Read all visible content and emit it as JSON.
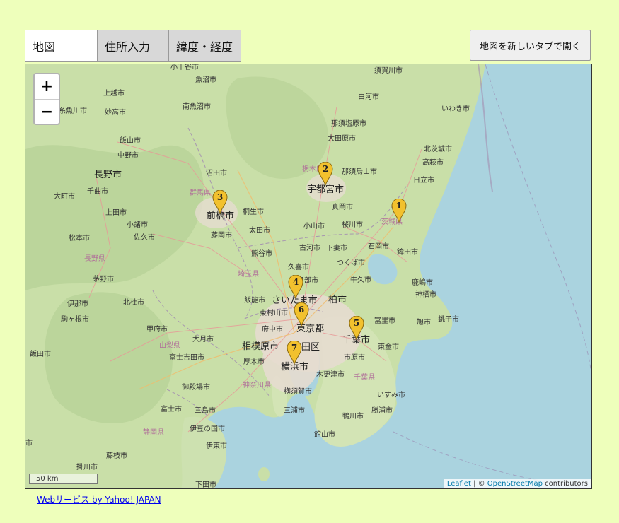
{
  "tabs": [
    {
      "label": "地図",
      "active": true
    },
    {
      "label": "住所入力",
      "active": false
    },
    {
      "label": "緯度・経度",
      "active": false
    }
  ],
  "open_new_tab_button": "地図を新しいタブで開く",
  "map": {
    "zoom_in": "+",
    "zoom_out": "−",
    "scale_label": "50 km",
    "attribution": {
      "leaflet": "Leaflet",
      "sep": " | © ",
      "osm": "OpenStreetMap",
      "suffix": " contributors"
    },
    "colors": {
      "sea": "#aad3df",
      "land": "#c9dfa8",
      "mountain": "#b8d297",
      "urban": "#e6dccf",
      "marker": "#f2c12e"
    },
    "markers": [
      "1",
      "2",
      "3",
      "4",
      "5",
      "6",
      "7"
    ],
    "labels": {
      "komagi": "小千谷市",
      "uonuma": "魚沼市",
      "sukagawa": "須賀川市",
      "joetsu": "上越市",
      "shirakawa": "白河市",
      "itoigawa": "糸魚川市",
      "myoko": "妙高市",
      "minamiuonuma": "南魚沼市",
      "iwaki": "いわき市",
      "iiyama": "飯山市",
      "nasushiobara": "那須塩原市",
      "nakano": "中野市",
      "otawara": "大田原市",
      "kitaibaraki": "北茨城市",
      "nagano": "長野市",
      "numata": "沼田市",
      "tochigi_pref": "栃木県",
      "nasukarasuyama": "那須烏山市",
      "takahagi": "高萩市",
      "chikuma": "千曲市",
      "gunma_pref": "群馬県",
      "utsunomiya": "宇都宮市",
      "hitachi": "日立市",
      "omachi": "大町市",
      "maebashi": "前橋市",
      "kiryu": "桐生市",
      "moka": "真岡市",
      "ueda": "上田市",
      "komoro": "小諸市",
      "ota": "太田市",
      "oyama": "小山市",
      "sakura": "桜川市",
      "ibaraki_pref": "茨城県",
      "matsumoto": "松本市",
      "saku": "佐久市",
      "fujioka": "藤岡市",
      "koga": "古河市",
      "shimotsuma": "下妻市",
      "ishioka": "石岡市",
      "hokota": "鉾田市",
      "nagano_pref": "長野県",
      "kumagaya": "熊谷市",
      "tsukuba": "つくば市",
      "kuki": "久喜市",
      "saitama_pref": "埼玉県",
      "ushiku": "牛久市",
      "chino": "茅野市",
      "kasukabe": "日部市",
      "kashima": "鹿嶋市",
      "kamisu": "神栖市",
      "ina": "伊那市",
      "hokuto": "北杜市",
      "saitama": "さいたま市",
      "kashiwa": "柏市",
      "hanno": "飯能市",
      "higashiyamato": "東村山市",
      "komagane": "駒ヶ根市",
      "kofu": "甲府市",
      "fuchu": "府中市",
      "tokyo": "東京都",
      "chiba": "千葉市",
      "tomisato": "富里市",
      "asahi": "旭市",
      "choshi": "銚子市",
      "otsuki": "大月市",
      "iida": "飯田市",
      "sagamihara": "相模原市",
      "ota_ku": "田区",
      "togane": "東金市",
      "yamanashi_pref": "山梨県",
      "fujiyoshida": "富士吉田市",
      "atsugi": "厚木市",
      "yokohama": "横浜市",
      "ichihara": "市原市",
      "kisarazu": "木更津市",
      "chiba_pref": "千葉県",
      "gotemba": "御殿場市",
      "kanagawa_pref": "神奈川県",
      "yokosuka": "横須賀市",
      "isumi": "いすみ市",
      "fuji": "富士市",
      "mishima": "三島市",
      "miura": "三浦市",
      "katsuura": "勝浦市",
      "kamogawa": "鴨川市",
      "izunokuni": "伊豆の国市",
      "shizuoka_pref": "静岡県",
      "tateyama": "館山市",
      "ito": "伊東市",
      "fujieda": "藤枝市",
      "kakegawa": "掛川市",
      "shimoda": "下田市",
      "city_edge": "市"
    }
  },
  "footer_link": "Webサービス by Yahoo! JAPAN"
}
